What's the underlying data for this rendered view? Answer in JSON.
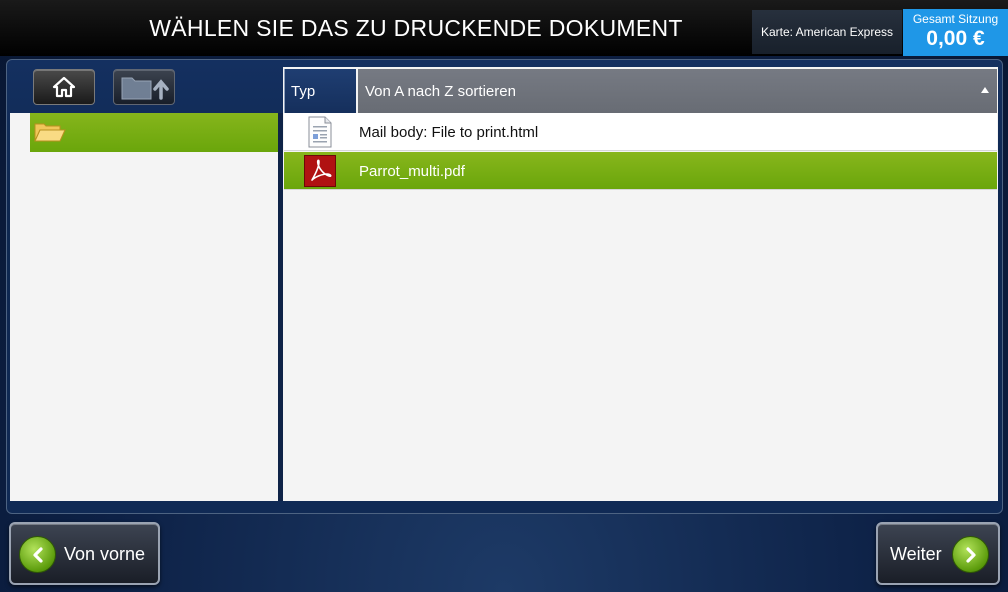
{
  "header": {
    "title": "WÄHLEN SIE DAS ZU DRUCKENDE DOKUMENT",
    "card_label": "Karte: American Express",
    "session_label": "Gesamt Sitzung",
    "session_amount": "0,00 €"
  },
  "toolbar": {
    "home_icon": "home-icon",
    "folder_up_icon": "folder-up-icon"
  },
  "tree": {
    "folder_icon": "open-folder-icon"
  },
  "table": {
    "col_type": "Typ",
    "col_name": "Von A nach Z sortieren",
    "sort": "ascending",
    "rows": [
      {
        "icon": "html-document-icon",
        "name": "Mail body: File to print.html",
        "selected": false
      },
      {
        "icon": "pdf-icon",
        "name": "Parrot_multi.pdf",
        "selected": true
      }
    ]
  },
  "nav": {
    "back_label": "Von vorne",
    "next_label": "Weiter"
  },
  "colors": {
    "accent_blue": "#1f97e7",
    "selected_green": "#7ab014",
    "header_type_blue": "#1f3e72",
    "header_name_gray": "#707480"
  }
}
